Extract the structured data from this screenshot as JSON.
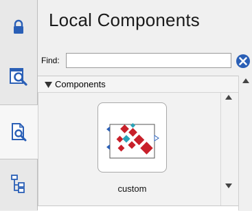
{
  "panel": {
    "title": "Local Components"
  },
  "find": {
    "label": "Find:",
    "value": "",
    "clear_icon": "clear-x-icon"
  },
  "tabs": [
    {
      "icon": "lock-icon"
    },
    {
      "icon": "library-browser-icon"
    },
    {
      "icon": "local-components-icon"
    },
    {
      "icon": "hierarchy-tree-icon"
    }
  ],
  "group": {
    "label": "Components",
    "expanded": true
  },
  "components": [
    {
      "label": "custom",
      "icon": "custom-component-icon"
    }
  ],
  "colors": {
    "accent_blue": "#2a5fb6",
    "component_red": "#c8202a",
    "component_cyan": "#2aa3b8"
  }
}
